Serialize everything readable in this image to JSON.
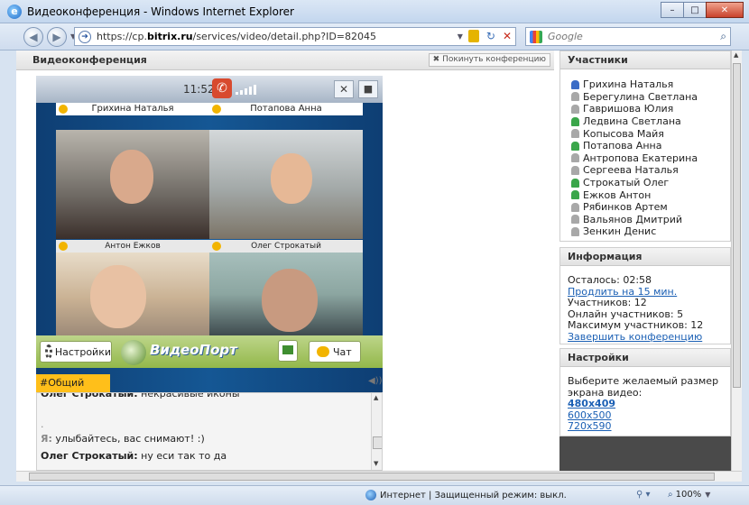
{
  "window": {
    "title": "Видеоконференция - Windows Internet Explorer"
  },
  "browser": {
    "url_prefix": "https://cp.",
    "url_domain": "bitrix.ru",
    "url_rest": "/services/video/detail.php?ID=82045",
    "search_placeholder": "Google"
  },
  "conference": {
    "title": "Видеоконференция",
    "leave_label": "✖ Покинуть конференцию",
    "clock": "11:52",
    "tiles": [
      {
        "name": "Грихина Наталья"
      },
      {
        "name": "Потапова Анна"
      },
      {
        "name": "Антон Ежков"
      },
      {
        "name": "Олег Строкатый"
      }
    ],
    "settings_label": "Настройки",
    "logo_text": "ВидеоПорт",
    "chat_label": "Чат"
  },
  "chat": {
    "tab": "#Общий",
    "lines": [
      {
        "author": "Олег Строкатый:",
        "text": " некрасивые иконы"
      },
      {
        "author": "",
        "text": "."
      },
      {
        "author": "Я:",
        "text": " улыбайтесь, вас снимают! :)"
      },
      {
        "author": "Олег Строкатый:",
        "text": " ну еси так то да"
      }
    ]
  },
  "participants": {
    "title": "Участники",
    "items": [
      {
        "name": "Грихина Наталья",
        "status": "blue"
      },
      {
        "name": "Берегулина Светлана",
        "status": "offline"
      },
      {
        "name": "Гавришова Юлия",
        "status": "offline"
      },
      {
        "name": "Ледвина Светлана",
        "status": "online"
      },
      {
        "name": "Копысова Майя",
        "status": "offline"
      },
      {
        "name": "Потапова Анна",
        "status": "online"
      },
      {
        "name": "Антропова Екатерина",
        "status": "offline"
      },
      {
        "name": "Сергеева Наталья",
        "status": "offline"
      },
      {
        "name": "Строкатый Олег",
        "status": "online"
      },
      {
        "name": "Ежков Антон",
        "status": "online"
      },
      {
        "name": "Рябинков Артем",
        "status": "offline"
      },
      {
        "name": "Вальянов Дмитрий",
        "status": "offline"
      },
      {
        "name": "Зенкин Денис",
        "status": "offline"
      }
    ]
  },
  "info": {
    "title": "Информация",
    "remaining": "Осталось: 02:58",
    "extend_link": "Продлить на 15 мин.",
    "participants": "Участников: 12",
    "online": "Онлайн участников: 5",
    "max": "Максимум участников: 12",
    "end_link": "Завершить конференцию"
  },
  "settings": {
    "title": "Настройки",
    "prompt": "Выберите желаемый размер экрана видео:",
    "sizes": [
      "480x409",
      "600x500",
      "720x590"
    ],
    "selected_size": "480x409"
  },
  "status": {
    "zone": "Интернет | Защищенный режим: выкл.",
    "zoom": "100%"
  },
  "colors": {
    "accent_yellow": "#ffbf1a",
    "video_bg": "#155794",
    "toolbar_green": "#93b84a",
    "link": "#1a5fb4"
  }
}
